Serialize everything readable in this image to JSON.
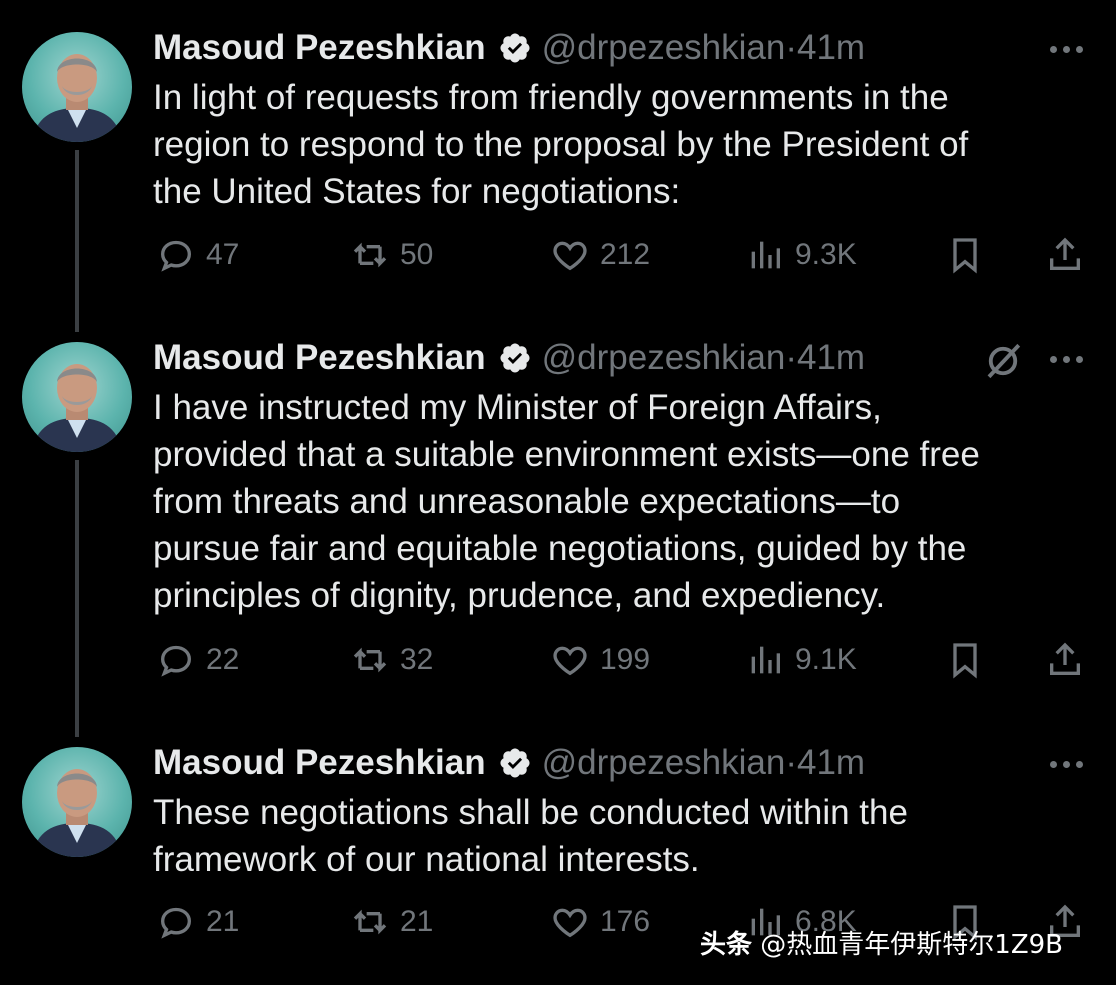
{
  "tweets": [
    {
      "author": "Masoud Pezeshkian",
      "handle": "@drpezeshkian",
      "time": "41m",
      "text": "In light of requests from friendly governments in the\nregion to respond to the proposal by the President of\nthe United States for negotiations:",
      "replies": "47",
      "retweets": "50",
      "likes": "212",
      "views": "9.3K"
    },
    {
      "author": "Masoud Pezeshkian",
      "handle": "@drpezeshkian",
      "time": "41m",
      "text": "I have instructed my Minister of Foreign Affairs,\nprovided that a suitable environment exists—one free\nfrom threats and unreasonable expectations—to\npursue fair and equitable negotiations, guided by the\nprinciples of dignity, prudence, and expediency.",
      "replies": "22",
      "retweets": "32",
      "likes": "199",
      "views": "9.1K"
    },
    {
      "author": "Masoud Pezeshkian",
      "handle": "@drpezeshkian",
      "time": "41m",
      "text": "These negotiations shall be conducted within the\nframework of our national interests.",
      "replies": "21",
      "retweets": "21",
      "likes": "176",
      "views": "6.8K"
    }
  ],
  "separator": "·",
  "watermark": {
    "brand": "头条",
    "account": "@热血青年伊斯特尔1Z9B"
  },
  "colors": {
    "background": "#000000",
    "text": "#e7e9ea",
    "muted": "#71767b",
    "verified": "#1d9bf0"
  },
  "icons": [
    "reply-icon",
    "retweet-icon",
    "like-icon",
    "views-icon",
    "bookmark-icon",
    "share-icon",
    "verified-badge-icon",
    "more-icon",
    "grok-slash-icon"
  ]
}
